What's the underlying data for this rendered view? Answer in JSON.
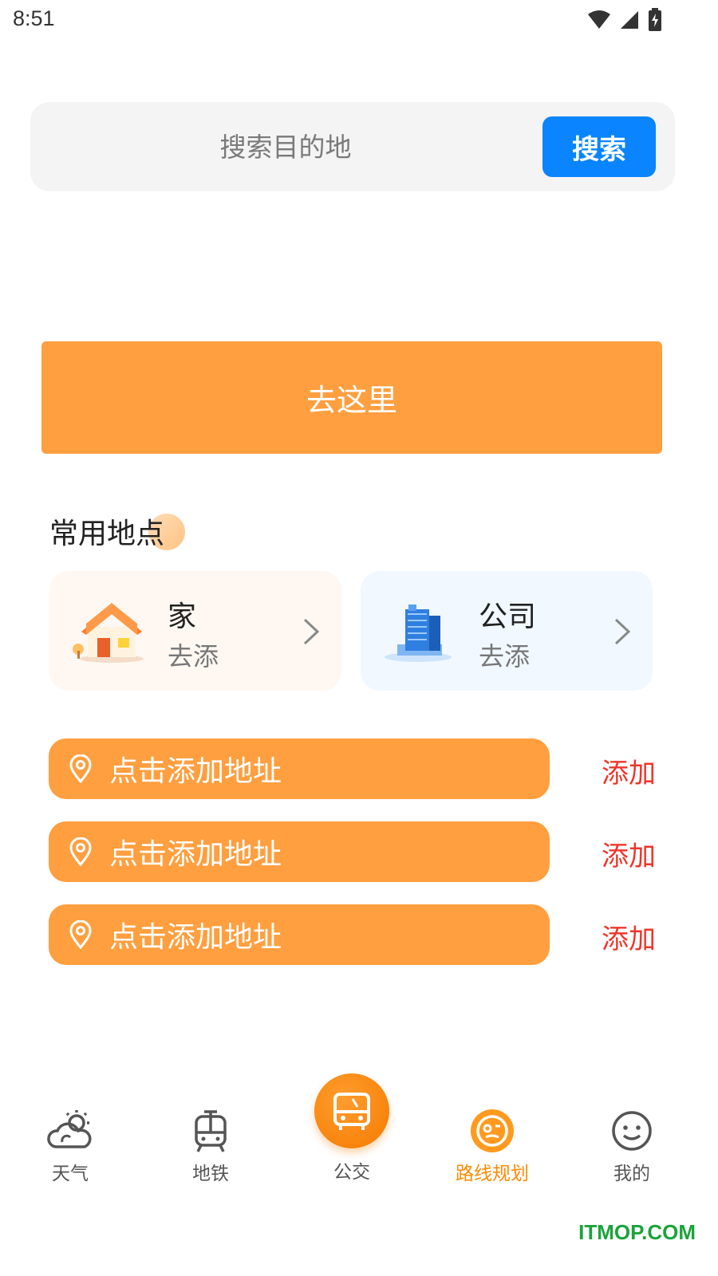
{
  "status_bar": {
    "time": "8:51"
  },
  "search": {
    "placeholder": "搜索目的地",
    "button_label": "搜索"
  },
  "go_button": {
    "label": "去这里"
  },
  "favorites": {
    "title": "常用地点",
    "items": [
      {
        "title": "家",
        "subtitle": "去添"
      },
      {
        "title": "公司",
        "subtitle": "去添"
      }
    ]
  },
  "addresses": [
    {
      "text": "点击添加地址",
      "action": "添加"
    },
    {
      "text": "点击添加地址",
      "action": "添加"
    },
    {
      "text": "点击添加地址",
      "action": "添加"
    }
  ],
  "nav": {
    "items": [
      {
        "label": "天气",
        "icon": "weather-icon"
      },
      {
        "label": "地铁",
        "icon": "subway-icon"
      },
      {
        "label": "公交",
        "icon": "bus-icon"
      },
      {
        "label": "路线规划",
        "icon": "route-icon",
        "active": true
      },
      {
        "label": "我的",
        "icon": "smile-icon"
      }
    ]
  },
  "watermark": "ITMOP.COM",
  "colors": {
    "accent": "#ff9f3f",
    "search_button": "#0a84ff",
    "add_text": "#f0352a",
    "nav_active": "#ff8a00"
  }
}
